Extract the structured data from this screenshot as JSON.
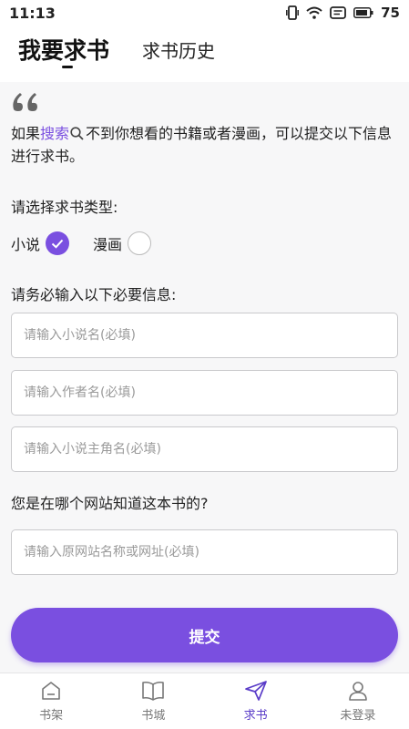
{
  "status_bar": {
    "time": "11:13",
    "battery": "75"
  },
  "tabs": {
    "active": "我要求书",
    "inactive": "求书历史"
  },
  "intro": {
    "before": "如果",
    "link": "搜索",
    "after": "不到你想看的书籍或者漫画，可以提交以下信息进行求书。"
  },
  "type_section": {
    "label": "请选择求书类型:",
    "options": [
      {
        "label": "小说",
        "selected": true
      },
      {
        "label": "漫画",
        "selected": false
      }
    ]
  },
  "info_section": {
    "label": "请务必输入以下必要信息:",
    "fields": [
      {
        "placeholder": "请输入小说名(必填)",
        "value": ""
      },
      {
        "placeholder": "请输入作者名(必填)",
        "value": ""
      },
      {
        "placeholder": "请输入小说主角名(必填)",
        "value": ""
      }
    ]
  },
  "source_section": {
    "label": "您是在哪个网站知道这本书的?",
    "field": {
      "placeholder": "请输入原网站名称或网址(必填)",
      "value": ""
    }
  },
  "submit_label": "提交",
  "bottom_nav": [
    {
      "label": "书架",
      "icon": "home-icon",
      "active": false
    },
    {
      "label": "书城",
      "icon": "book-icon",
      "active": false
    },
    {
      "label": "求书",
      "icon": "send-icon",
      "active": true
    },
    {
      "label": "未登录",
      "icon": "user-icon",
      "active": false
    }
  ],
  "colors": {
    "accent": "#7a4fe0",
    "nav_active": "#5a3cc8"
  }
}
